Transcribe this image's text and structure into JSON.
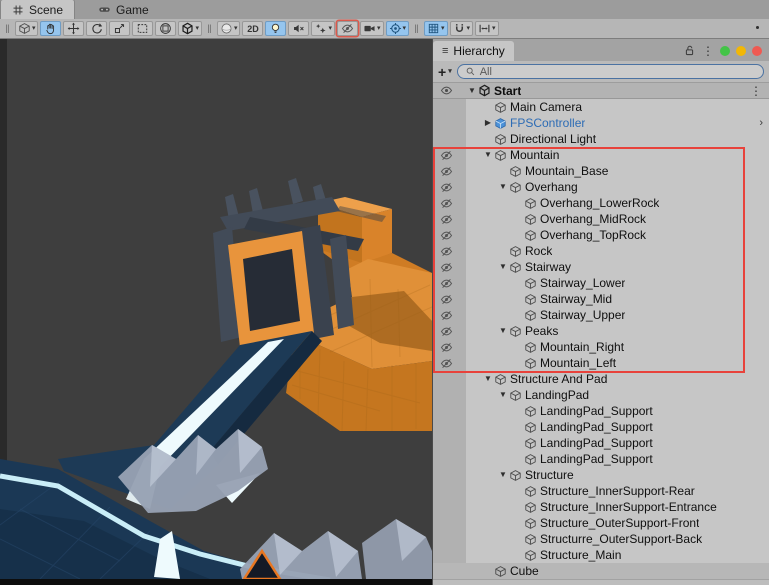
{
  "tabs": {
    "scene": {
      "label": "Scene",
      "icon": "scene-grid-icon",
      "active": true
    },
    "game": {
      "label": "Game",
      "icon": "gamepad-icon",
      "active": false
    }
  },
  "icons": {
    "kebab": "⋮",
    "dropdown": "▾",
    "expanded": "▼",
    "collapsed": "▶",
    "separator": "‖",
    "chevron": "›",
    "plus": "+"
  },
  "toolbar": {
    "buttons": [
      {
        "name": "toolbar-drag-handle",
        "icon": "separator"
      },
      {
        "name": "view-options-button",
        "icon": "cube-outline-icon",
        "dropdown": true
      },
      {
        "name": "hand-tool-button",
        "icon": "hand-icon",
        "active": true
      },
      {
        "name": "move-tool-button",
        "icon": "move-icon"
      },
      {
        "name": "rotate-tool-button",
        "icon": "rotate-icon"
      },
      {
        "name": "scale-tool-button",
        "icon": "scale-icon"
      },
      {
        "name": "rect-tool-button",
        "icon": "rect-icon"
      },
      {
        "name": "transform-tool-button",
        "icon": "transform-icon"
      },
      {
        "name": "custom-tool-button",
        "icon": "unity-logo-icon",
        "dropdown": true
      },
      {
        "name": "toolbar-separator",
        "icon": "separator"
      },
      {
        "name": "shading-mode-button",
        "icon": "sphere-icon",
        "dropdown": true
      },
      {
        "name": "mode-2d-button",
        "icon": "text",
        "glyph": "2D"
      },
      {
        "name": "lighting-toggle-button",
        "icon": "lightbulb-icon",
        "active": true
      },
      {
        "name": "audio-mute-button",
        "icon": "audio-muted-icon"
      },
      {
        "name": "effects-toggle-button",
        "icon": "effects-stars-icon",
        "dropdown": true
      },
      {
        "name": "scene-visibility-button",
        "icon": "eye-slash-icon",
        "outlined": true
      },
      {
        "name": "camera-view-button",
        "icon": "camera-icon",
        "dropdown": true
      },
      {
        "name": "gizmos-toggle-button",
        "icon": "gizmo-target-icon",
        "active": true,
        "dropdown": true
      },
      {
        "name": "toolbar-separator",
        "icon": "separator"
      },
      {
        "name": "grid-snap-button",
        "icon": "grid-snap-icon",
        "active": true,
        "dropdown": true
      },
      {
        "name": "magnet-snap-button",
        "icon": "magnet-icon",
        "dropdown": true
      },
      {
        "name": "move-snap-button",
        "icon": "move-snap-icon",
        "dropdown": true
      }
    ]
  },
  "hierarchy": {
    "tab_label": "Hierarchy",
    "window_dots": [
      "#43c447",
      "#f2b705",
      "#ef5a52"
    ],
    "search": {
      "placeholder": "All"
    },
    "scene_row": {
      "label": "Start",
      "icon": "unity-scene-icon"
    },
    "annotation_color": "#e8423b",
    "rows": [
      {
        "label": "Main Camera",
        "depth": 1
      },
      {
        "label": "FPSController",
        "depth": 1,
        "arrow": "right",
        "icon": "prefab",
        "blue": true,
        "chevron": true
      },
      {
        "label": "Directional Light",
        "depth": 1
      },
      {
        "label": "Mountain",
        "depth": 1,
        "arrow": "down",
        "hidden": true
      },
      {
        "label": "Mountain_Base",
        "depth": 2,
        "hidden": true
      },
      {
        "label": "Overhang",
        "depth": 2,
        "arrow": "down",
        "hidden": true
      },
      {
        "label": "Overhang_LowerRock",
        "depth": 3,
        "hidden": true
      },
      {
        "label": "Overhang_MidRock",
        "depth": 3,
        "hidden": true
      },
      {
        "label": "Overhang_TopRock",
        "depth": 3,
        "hidden": true
      },
      {
        "label": "Rock",
        "depth": 2,
        "hidden": true
      },
      {
        "label": "Stairway",
        "depth": 2,
        "arrow": "down",
        "hidden": true
      },
      {
        "label": "Stairway_Lower",
        "depth": 3,
        "hidden": true
      },
      {
        "label": "Stairway_Mid",
        "depth": 3,
        "hidden": true
      },
      {
        "label": "Stairway_Upper",
        "depth": 3,
        "hidden": true
      },
      {
        "label": "Peaks",
        "depth": 2,
        "arrow": "down",
        "hidden": true
      },
      {
        "label": "Mountain_Right",
        "depth": 3,
        "hidden": true
      },
      {
        "label": "Mountain_Left",
        "depth": 3,
        "hidden": true
      },
      {
        "label": "Structure And Pad",
        "depth": 1,
        "arrow": "down"
      },
      {
        "label": "LandingPad",
        "depth": 2,
        "arrow": "down"
      },
      {
        "label": "LandingPad_Support",
        "depth": 3
      },
      {
        "label": "LandingPad_Support",
        "depth": 3
      },
      {
        "label": "LandingPad_Support",
        "depth": 3
      },
      {
        "label": "LandingPad_Support",
        "depth": 3
      },
      {
        "label": "Structure",
        "depth": 2,
        "arrow": "down"
      },
      {
        "label": "Structure_InnerSupport-Rear",
        "depth": 3
      },
      {
        "label": "Structure_InnerSupport-Entrance",
        "depth": 3
      },
      {
        "label": "Structure_OuterSupport-Front",
        "depth": 3
      },
      {
        "label": "Structurre_OuterSupport-Back",
        "depth": 3
      },
      {
        "label": "Structure_Main",
        "depth": 3
      },
      {
        "label": "Cube",
        "depth": 1,
        "highlight": true
      }
    ]
  },
  "scene": {
    "colors": {
      "bg": "#3e3e3e",
      "edge": "#2a2a2a",
      "bottom": "#0d0d0d",
      "terrain_top": "#e09038",
      "terrain_side": "#c5761f",
      "terrain_shadow": "#a4661e",
      "terrain_fill": "#cf7c24",
      "box_top": "#eda04b",
      "box_right": "#d9832a",
      "box_left": "#c2741e",
      "slab": "#424b58",
      "slab_dark": "#333b46",
      "slab_mid": "#3a424e",
      "slab_light": "#49525f",
      "arch_orange": "#e8943c",
      "doorway": "#262c36",
      "bridge_top": "#1d3a56",
      "bridge_side": "#152a40",
      "stripe_white": "#eefafd",
      "stripe_cyan": "#c9edf7",
      "pad": "#1b3855",
      "pad_dark": "#16304a",
      "pad_grid": "#27486c",
      "ghost": "#97a1b3",
      "ghost_light": "#b9c2d1",
      "gizmo": "#e87722",
      "grid_line": "#9a6118"
    }
  }
}
